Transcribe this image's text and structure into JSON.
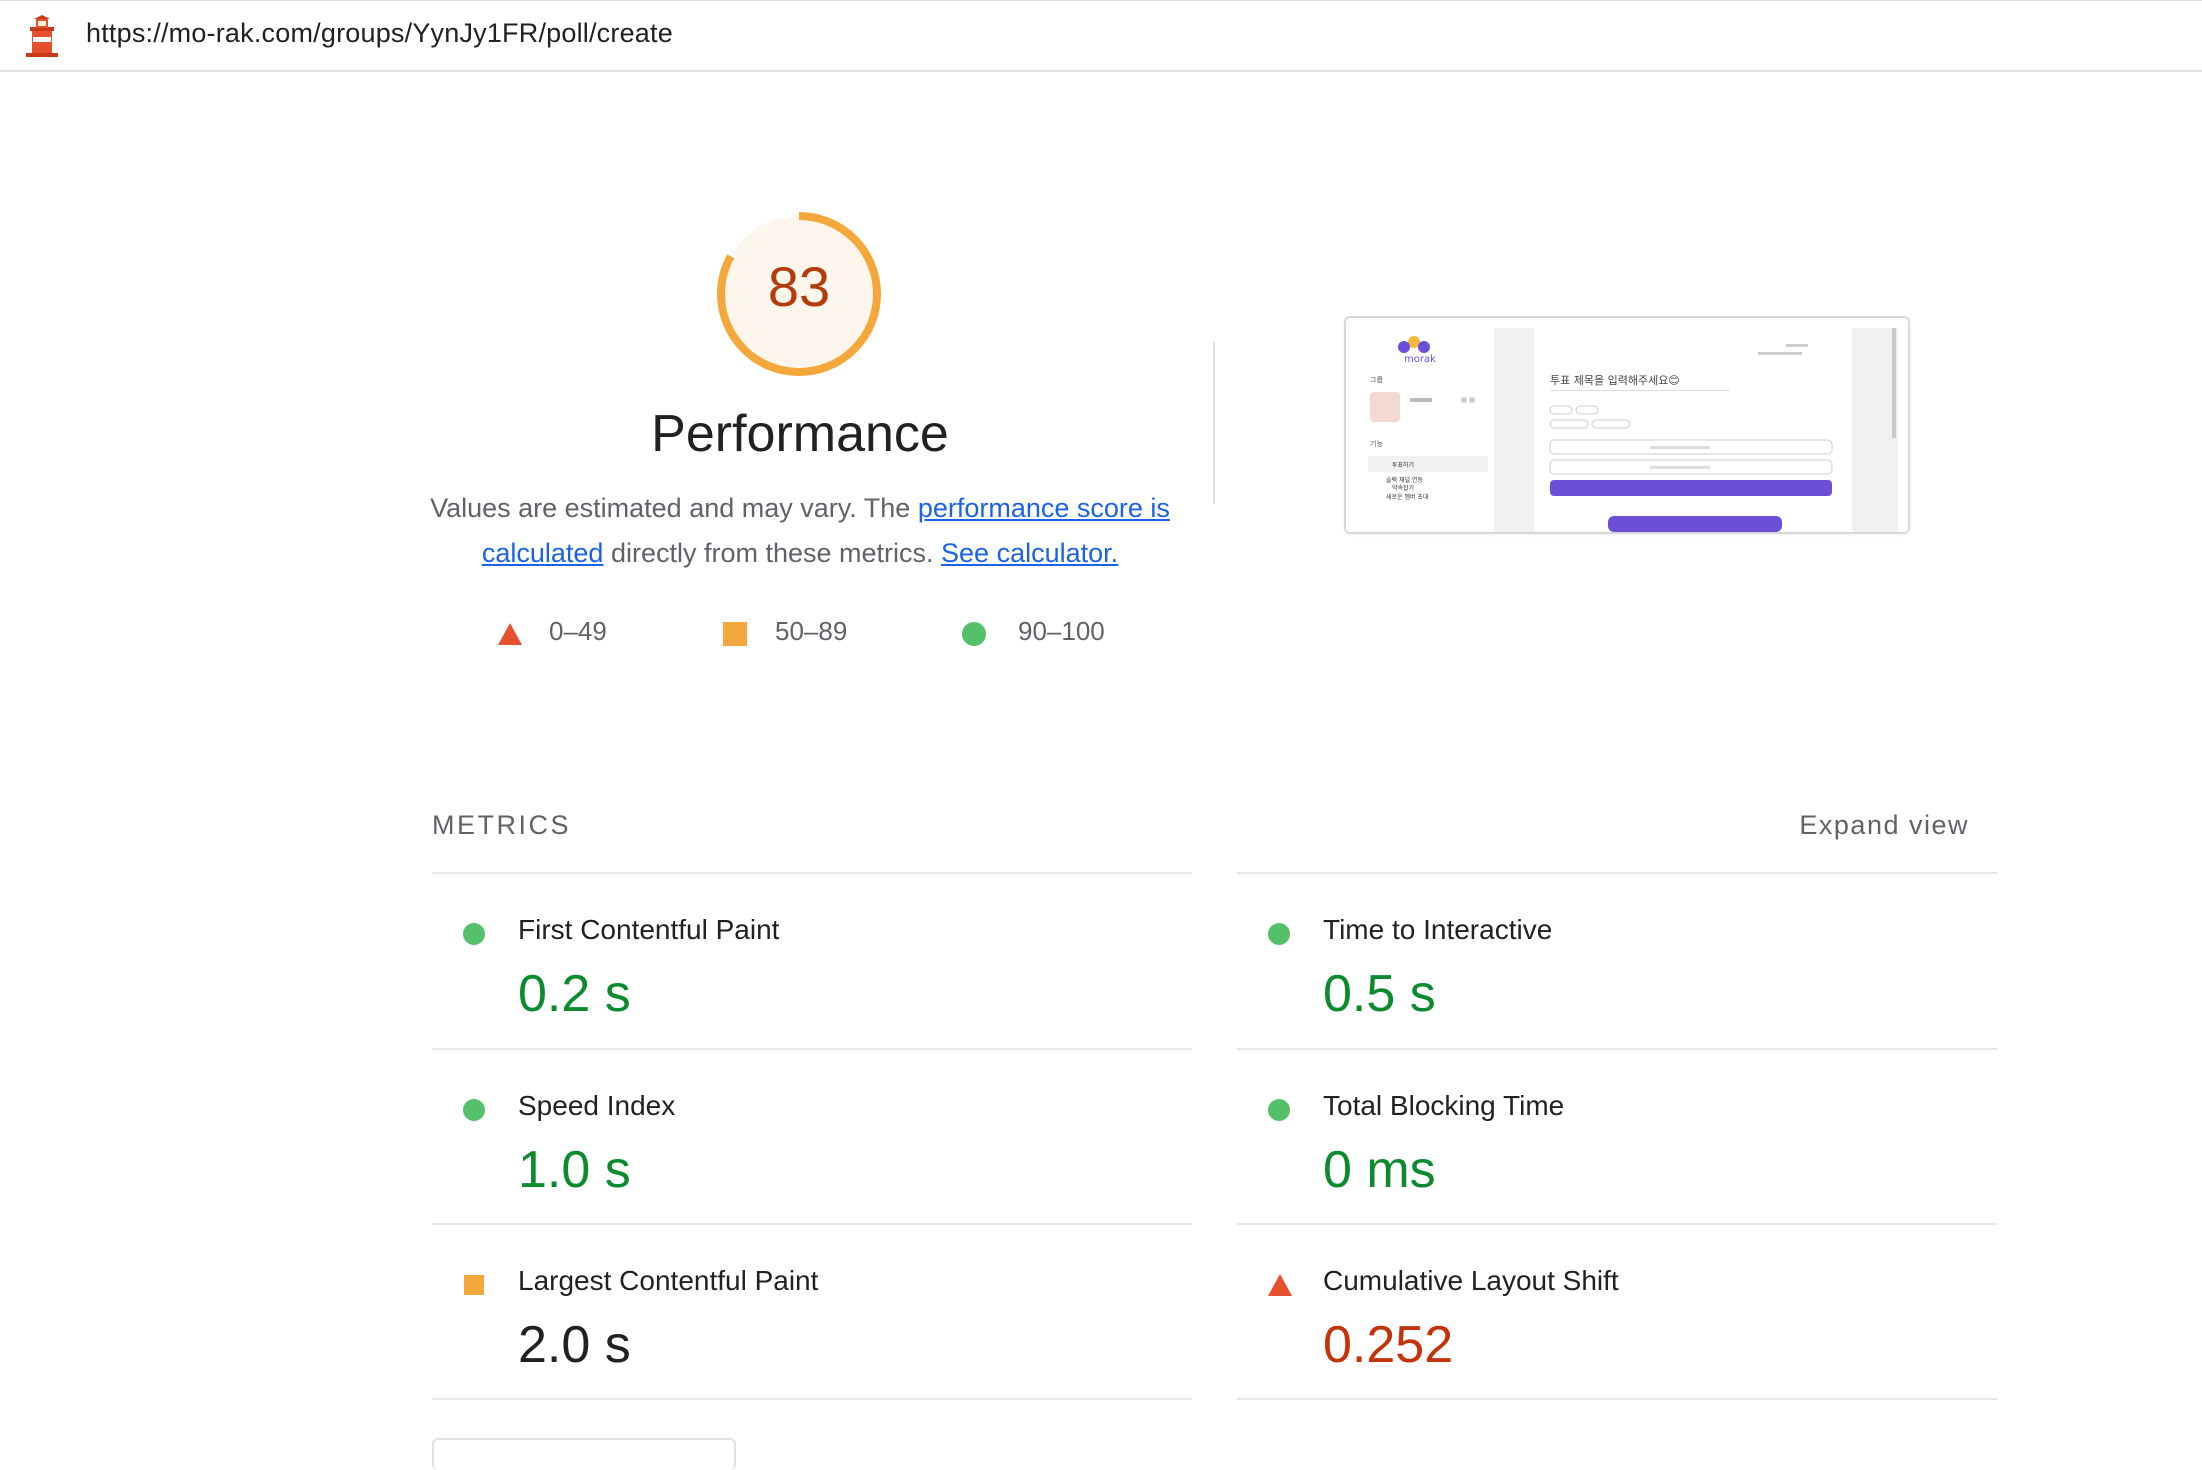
{
  "url_bar": {
    "url": "https://mo-rak.com/groups/YynJy1FR/poll/create"
  },
  "gauge": {
    "score": "83",
    "score_fraction": 0.83,
    "color": "#f4a83c",
    "fill": "#fdf6ec",
    "text_color": "#b23c0a"
  },
  "category": {
    "title": "Performance",
    "desc_prefix": "Values are estimated and may vary. The ",
    "desc_link": "performance score is calculated",
    "desc_middle": " directly from these metrics.",
    "calculator_link": "See calculator."
  },
  "legend": [
    {
      "range": "0–49",
      "icon": "fail-triangle-icon",
      "color": "#e5502e"
    },
    {
      "range": "50–89",
      "icon": "average-square-icon",
      "color": "#f4a83c"
    },
    {
      "range": "90–100",
      "icon": "pass-circle-icon",
      "color": "#54c06a"
    }
  ],
  "thumbnail": {
    "logo_text": "morak",
    "poll_title_placeholder": "투표 제목을 입력해주세요😊",
    "side_group": "그룹",
    "side_features": "기능",
    "side_item_1": "투표하기",
    "side_item_2": "슬랙 채널 연동",
    "side_item_3": "약속잡기",
    "side_item_4": "새로운 멤버 초대"
  },
  "metrics": {
    "header": "METRICS",
    "expand": "Expand view",
    "items": [
      {
        "label": "First Contentful Paint",
        "value": "0.2 s",
        "status": "pass"
      },
      {
        "label": "Time to Interactive",
        "value": "0.5 s",
        "status": "pass"
      },
      {
        "label": "Speed Index",
        "value": "1.0 s",
        "status": "pass"
      },
      {
        "label": "Total Blocking Time",
        "value": "0 ms",
        "status": "pass"
      },
      {
        "label": "Largest Contentful Paint",
        "value": "2.0 s",
        "status": "average"
      },
      {
        "label": "Cumulative Layout Shift",
        "value": "0.252",
        "status": "fail"
      }
    ]
  }
}
